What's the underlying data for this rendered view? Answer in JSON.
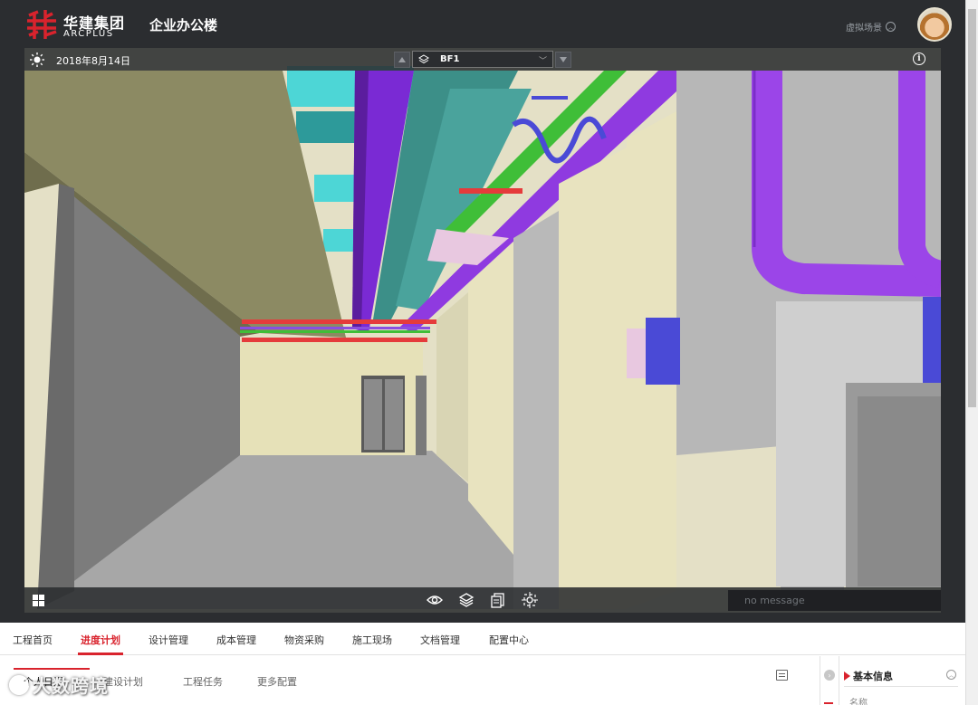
{
  "header": {
    "brand_cn": "华建集团",
    "brand_en": "ARCPLUS",
    "project_title": "企业办公楼",
    "virtual_scene_label": "虚拟场景",
    "brand_color": "#d9232d"
  },
  "viewer": {
    "date": "2018年8月14日",
    "floor": "BF1",
    "message_placeholder": "no message",
    "tools": [
      "eye-icon",
      "layers-icon",
      "document-icon",
      "locate-icon"
    ]
  },
  "nav": {
    "tabs": [
      {
        "label": "工程首页"
      },
      {
        "label": "进度计划",
        "active": true
      },
      {
        "label": "设计管理"
      },
      {
        "label": "成本管理"
      },
      {
        "label": "物资采购"
      },
      {
        "label": "施工现场"
      },
      {
        "label": "文档管理"
      },
      {
        "label": "配置中心"
      }
    ],
    "active_color": "#d9232d"
  },
  "subnav": {
    "tabs": [
      {
        "label": "个人日历",
        "active": true
      },
      {
        "label": "建设计划"
      },
      {
        "label": "工程任务"
      },
      {
        "label": "更多配置"
      }
    ]
  },
  "info_panel": {
    "title": "基本信息",
    "field_name_label": "名称"
  },
  "watermark": "大数跨境"
}
